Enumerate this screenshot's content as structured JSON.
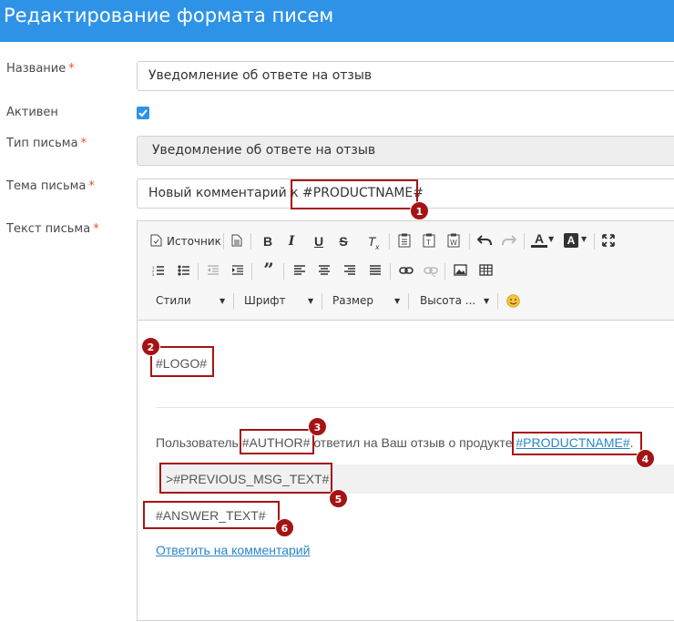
{
  "page": {
    "title": "Редактирование формата писем"
  },
  "form": {
    "name_label": "Название",
    "name_value": "Уведомление об ответе на отзыв",
    "active_label": "Активен",
    "type_label": "Тип письма",
    "type_value": "Уведомление об ответе на отзыв",
    "subject_label": "Тема письма",
    "subject_value": "Новый комментарий к #PRODUCTNAME#",
    "body_label": "Текст письма",
    "required_mark": "*"
  },
  "toolbar": {
    "source_label": "Источник",
    "styles_label": "Стили",
    "font_label": "Шрифт",
    "size_label": "Размер",
    "height_label": "Высота ...",
    "icons": [
      "source-icon",
      "document-icon",
      "bold-icon",
      "italic-icon",
      "underline-icon",
      "strikethrough-icon",
      "remove-format-icon",
      "paste-icon",
      "paste-text-icon",
      "paste-word-icon",
      "undo-icon",
      "redo-icon",
      "text-color-icon",
      "background-color-icon",
      "maximize-icon",
      "numbered-list-icon",
      "bulleted-list-icon",
      "outdent-icon",
      "indent-icon",
      "blockquote-icon",
      "align-left-icon",
      "align-center-icon",
      "align-right-icon",
      "justify-icon",
      "link-icon",
      "unlink-icon",
      "image-icon",
      "table-icon",
      "smiley-icon"
    ]
  },
  "content": {
    "logo": "#LOGO#",
    "line_prefix": "Пользователь ",
    "author": "#AUTHOR#",
    "line_middle": " ответил на Ваш отзыв о продукте ",
    "product_link": "#PRODUCTNAME#",
    "line_end": ".",
    "quote_marker": ">",
    "previous_msg": "#PREVIOUS_MSG_TEXT#",
    "answer_text": "#ANSWER_TEXT#",
    "reply_link": "Ответить на комментарий"
  },
  "annotations": {
    "badges": [
      "1",
      "2",
      "3",
      "4",
      "5",
      "6"
    ],
    "color": "#a51414"
  },
  "colors": {
    "header": "#2e93e6",
    "required": "#e2513d",
    "link": "#2a86c8"
  }
}
